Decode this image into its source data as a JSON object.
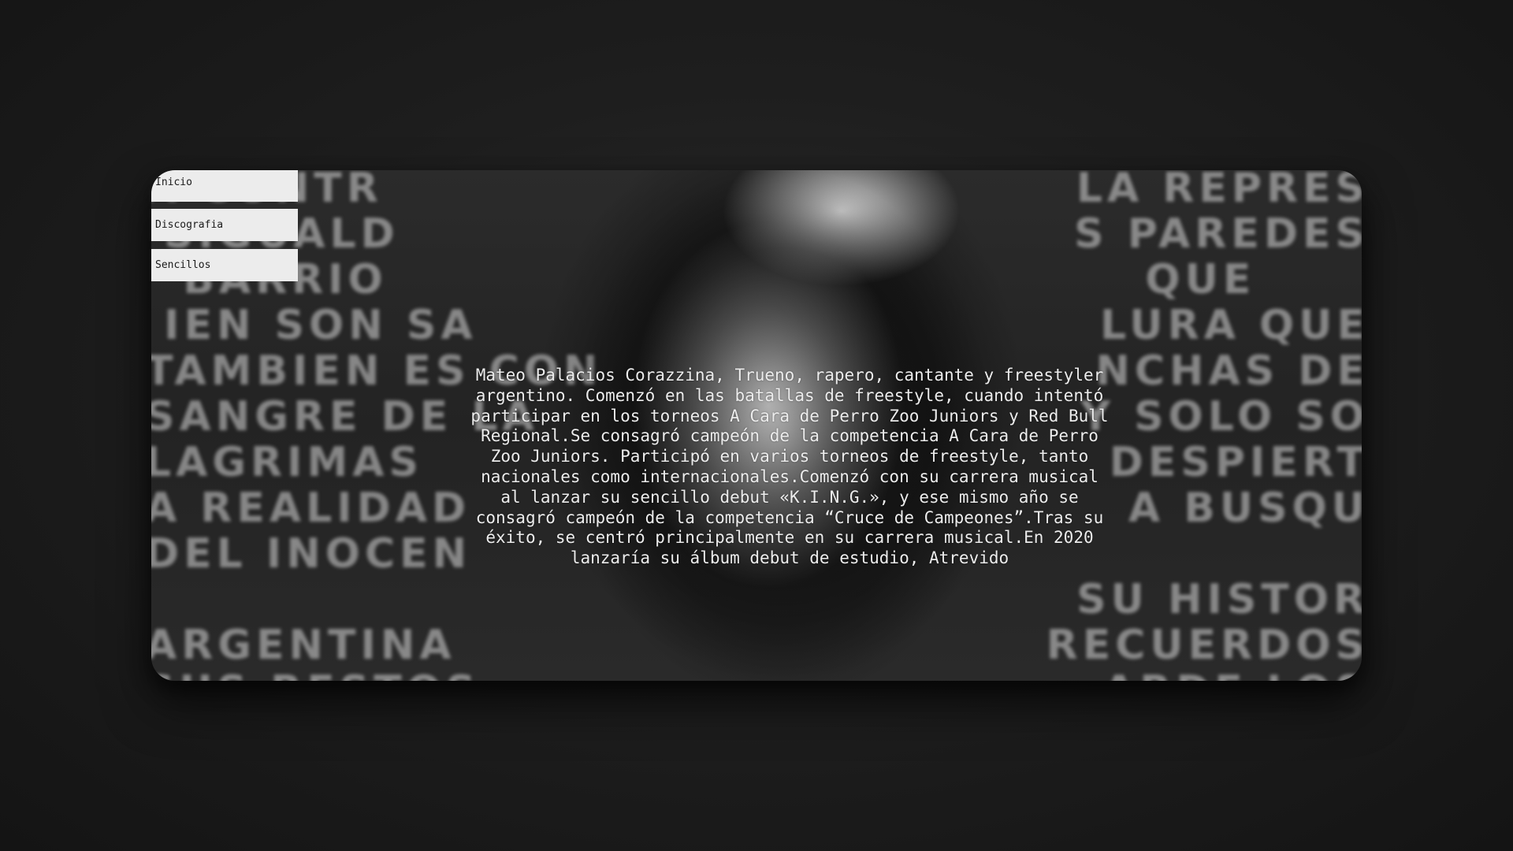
{
  "nav": {
    "items": [
      {
        "label": "Inicio"
      },
      {
        "label": "Discografia"
      },
      {
        "label": "Sencillos"
      }
    ]
  },
  "hero": {
    "bio": "Mateo Palacios Corazzina, Trueno, rapero, cantante y freestyler argentino. Comenzó en las batallas de freestyle, cuando intentó participar en los torneos A Cara de Perro Zoo Juniors y Red Bull Regional.Se consagró campeón de la competencia A Cara de Perro Zoo Juniors. Participó en varios torneos de freestyle, tanto nacionales como internacionales.Comenzó con su carrera musical al lanzar su sencillo debut «K.I.N.G.», y ese mismo año se consagró campeón de la competencia “Cruce de Campeones”.Tras su éxito, se centró principalmente en su carrera musical.En 2020 lanzaría su álbum debut de estudio, Atrevido"
  },
  "colors": {
    "page_background": "#1e1e1e",
    "nav_background": "#ececec",
    "nav_text": "#1b1b1b",
    "bio_text": "#ececec"
  }
}
